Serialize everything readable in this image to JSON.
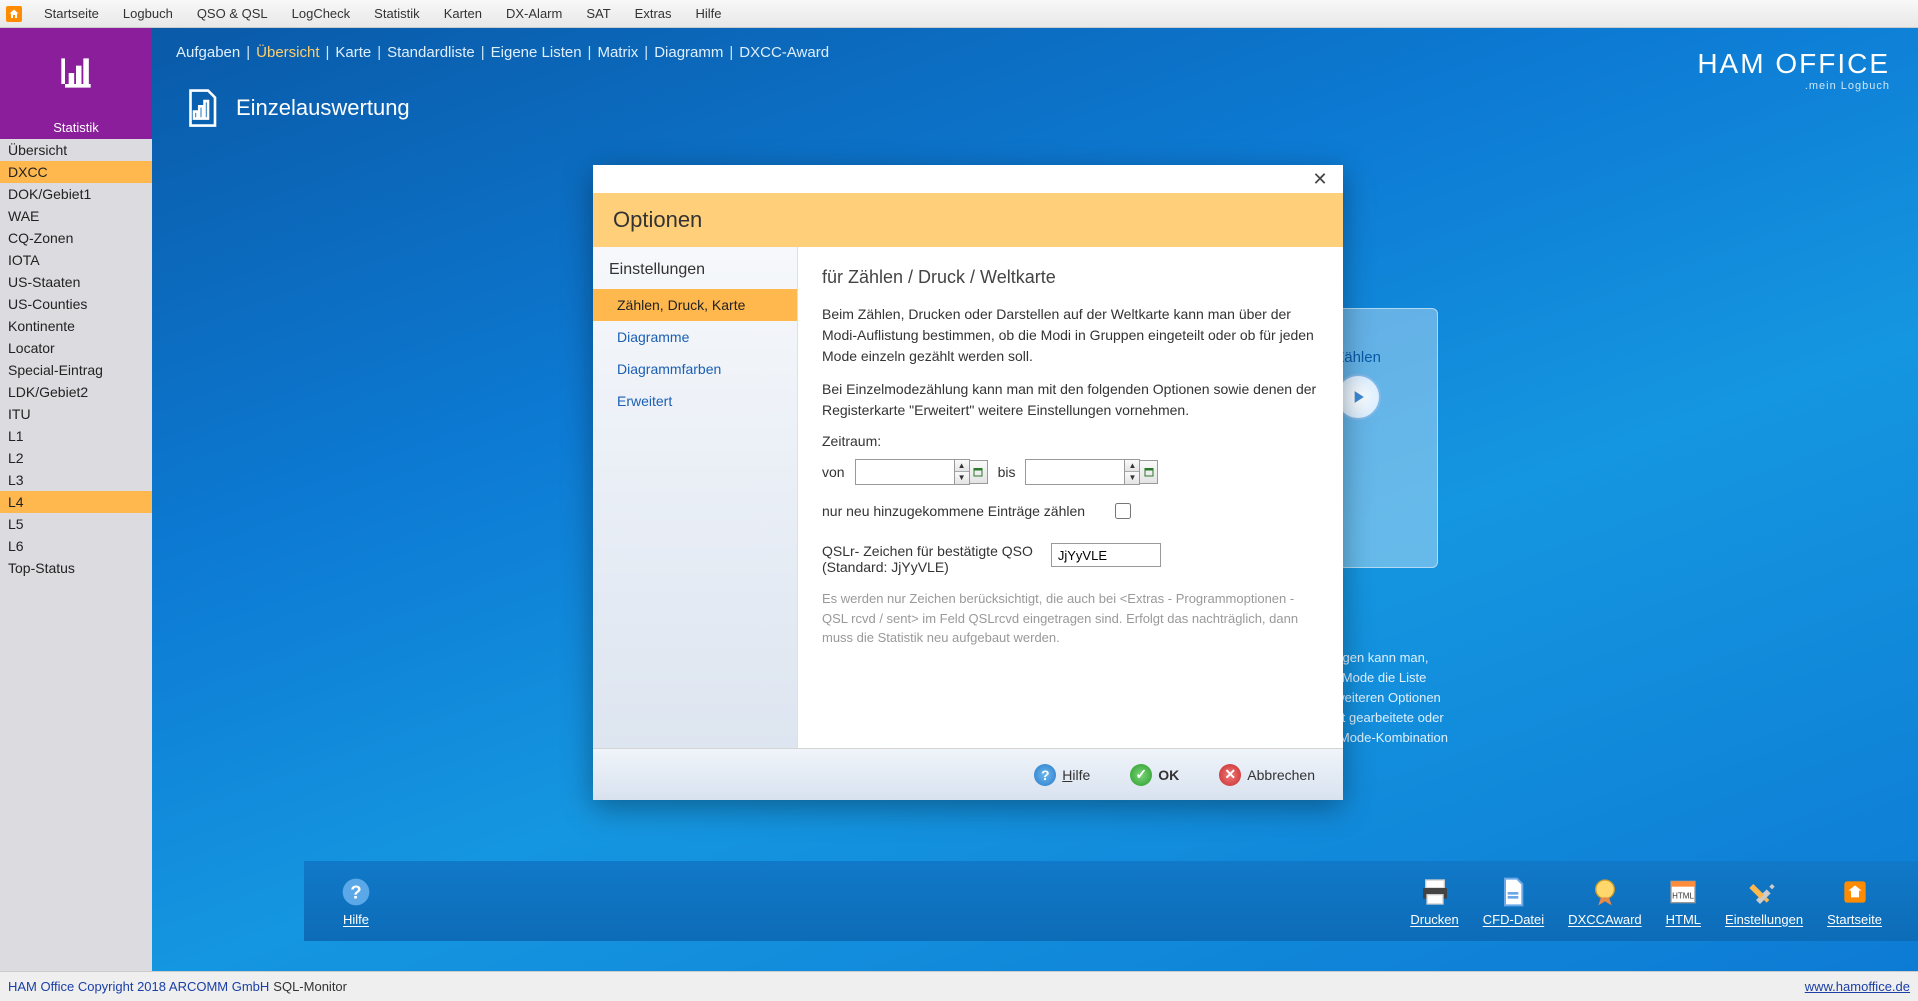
{
  "menubar": [
    "Startseite",
    "Logbuch",
    "QSO & QSL",
    "LogCheck",
    "Statistik",
    "Karten",
    "DX-Alarm",
    "SAT",
    "Extras",
    "Hilfe"
  ],
  "leftTile": {
    "label": "Statistik"
  },
  "sidelist": [
    {
      "label": "Übersicht",
      "active": false
    },
    {
      "label": "DXCC",
      "active": true
    },
    {
      "label": "DOK/Gebiet1",
      "active": false
    },
    {
      "label": "WAE",
      "active": false
    },
    {
      "label": "CQ-Zonen",
      "active": false
    },
    {
      "label": "IOTA",
      "active": false
    },
    {
      "label": "US-Staaten",
      "active": false
    },
    {
      "label": "US-Counties",
      "active": false
    },
    {
      "label": "Kontinente",
      "active": false
    },
    {
      "label": "Locator",
      "active": false
    },
    {
      "label": "Special-Eintrag",
      "active": false
    },
    {
      "label": "LDK/Gebiet2",
      "active": false
    },
    {
      "label": "ITU",
      "active": false
    },
    {
      "label": "L1",
      "active": false
    },
    {
      "label": "L2",
      "active": false
    },
    {
      "label": "L3",
      "active": false
    },
    {
      "label": "L4",
      "active": true
    },
    {
      "label": "L5",
      "active": false
    },
    {
      "label": "L6",
      "active": false
    },
    {
      "label": "Top-Status",
      "active": false
    }
  ],
  "subnav": {
    "items": [
      "Aufgaben",
      "Übersicht",
      "Karte",
      "Standardliste",
      "Eigene Listen",
      "Matrix",
      "Diagramm",
      "DXCC-Award"
    ],
    "activeIndex": 1
  },
  "brand": {
    "line1": "HAM OFFICE",
    "line2": ".mein Logbuch"
  },
  "pageTitle": "Einzelauswertung",
  "zpanel": {
    "label": "Zählen"
  },
  "hintlines": [
    "ngen kann man,",
    "l/Mode die Liste",
    "weiteren Optionen",
    "st gearbeitete oder",
    "/Mode-Kombination"
  ],
  "bottombar": {
    "help": "Hilfe",
    "buttons": [
      {
        "name": "drucken",
        "label": "Drucken"
      },
      {
        "name": "cfd",
        "label": "CFD-Datei"
      },
      {
        "name": "dxcc",
        "label": "DXCCAward"
      },
      {
        "name": "html",
        "label": "HTML"
      },
      {
        "name": "settings",
        "label": "Einstellungen"
      },
      {
        "name": "start",
        "label": "Startseite"
      }
    ]
  },
  "statusbar": {
    "copyright": "HAM Office Copyright 2018 ARCOMM GmbH",
    "mid": "SQL-Monitor",
    "url": "www.hamoffice.de"
  },
  "dialog": {
    "title": "Optionen",
    "sideHeader": "Einstellungen",
    "sideItems": [
      {
        "label": "Zählen, Druck, Karte",
        "active": true
      },
      {
        "label": "Diagramme",
        "active": false
      },
      {
        "label": "Diagrammfarben",
        "active": false
      },
      {
        "label": "Erweitert",
        "active": false
      }
    ],
    "mainTitle": "für Zählen / Druck / Weltkarte",
    "para1": "Beim Zählen, Drucken oder Darstellen auf der Weltkarte kann man über der Modi-Auflistung bestimmen, ob die Modi in Gruppen eingeteilt oder ob für jeden Mode einzeln gezählt werden soll.",
    "para2": "Bei Einzelmodezählung kann man mit den folgenden Optionen sowie denen der Registerkarte \"Erweitert\" weitere Einstellungen vornehmen.",
    "zeitraumLabel": "Zeitraum:",
    "vonLabel": "von",
    "bisLabel": "bis",
    "vonValue": "",
    "bisValue": "",
    "chkLabel": "nur neu hinzugekommene Einträge zählen",
    "chkValue": false,
    "qslLabel1": "QSLr- Zeichen für bestätigte QSO",
    "qslLabel2": "(Standard: JjYyVLE)",
    "qslValue": "JjYyVLE",
    "note": "Es werden nur Zeichen berücksichtigt, die auch bei <Extras - Programmoptionen - QSL rcvd / sent> im Feld QSLrcvd eingetragen sind. Erfolgt das nachträglich, dann muss die Statistik neu aufgebaut werden.",
    "footer": {
      "help": "Hilfe",
      "ok": "OK",
      "cancel": "Abbrechen"
    }
  }
}
